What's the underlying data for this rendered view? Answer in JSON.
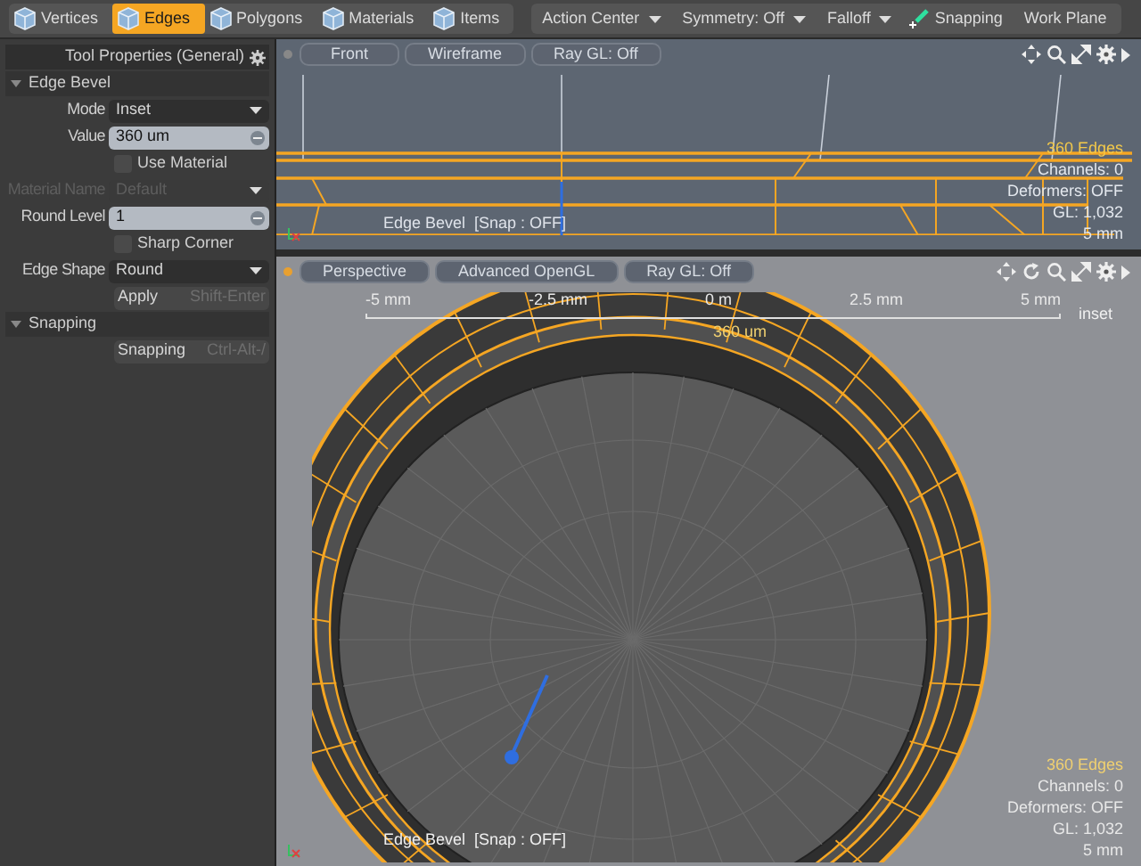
{
  "toolbar": {
    "modes": [
      {
        "label": "Vertices",
        "selected": false
      },
      {
        "label": "Edges",
        "selected": true
      },
      {
        "label": "Polygons",
        "selected": false
      },
      {
        "label": "Materials",
        "selected": false
      },
      {
        "label": "Items",
        "selected": false
      }
    ],
    "menus": [
      {
        "label": "Action Center",
        "kind": "dropdown"
      },
      {
        "label": "Symmetry: Off",
        "kind": "dropdown"
      },
      {
        "label": "Falloff",
        "kind": "dropdown"
      },
      {
        "label": "Snapping",
        "kind": "toggle"
      },
      {
        "label": "Work Plane",
        "kind": "plain"
      }
    ]
  },
  "panel": {
    "title": "Tool Properties (General)",
    "sections": [
      {
        "title": "Edge Bevel",
        "expanded": true,
        "fields": [
          {
            "kind": "dropdown",
            "label": "Mode",
            "value": "Inset",
            "disabled": false
          },
          {
            "kind": "number",
            "label": "Value",
            "value": "360 um",
            "disabled": false
          },
          {
            "kind": "checkbox",
            "label": "Use Material",
            "checked": false,
            "disabled": false
          },
          {
            "kind": "dropdown",
            "label": "Material Name",
            "value": "Default",
            "disabled": true
          },
          {
            "kind": "number",
            "label": "Round Level",
            "value": "1",
            "disabled": false
          },
          {
            "kind": "checkbox",
            "label": "Sharp Corner",
            "checked": false,
            "disabled": false
          },
          {
            "kind": "dropdown",
            "label": "Edge Shape",
            "value": "Round",
            "disabled": false
          },
          {
            "kind": "button",
            "label": "Apply",
            "shortcut": "Shift-Enter",
            "disabled": false
          }
        ]
      },
      {
        "title": "Snapping",
        "expanded": true,
        "fields": [
          {
            "kind": "button",
            "label": "Snapping",
            "shortcut": "Ctrl-Alt-/",
            "disabled": false
          }
        ]
      }
    ]
  },
  "viewports": [
    {
      "kind": "front",
      "buttons": [
        "Front",
        "Wireframe",
        "Ray GL: Off"
      ],
      "status": "Edge Bevel  [Snap : OFF]",
      "stats": {
        "selection": "360 Edges",
        "lines": [
          "Channels: 0",
          "Deformers: OFF",
          "GL: 1,032",
          "5 mm"
        ]
      }
    },
    {
      "kind": "perspective",
      "buttons": [
        "Perspective",
        "Advanced OpenGL",
        "Ray GL: Off"
      ],
      "ruler": [
        "-5 mm",
        "-2.5 mm",
        "0 m",
        "2.5 mm",
        "5 mm"
      ],
      "ruler_value": "360 um",
      "ruler_caption": "inset",
      "status": "Edge Bevel  [Snap : OFF]",
      "stats": {
        "selection": "360 Edges",
        "lines": [
          "Channels: 0",
          "Deformers: OFF",
          "GL: 1,032",
          "5 mm"
        ]
      }
    }
  ]
}
